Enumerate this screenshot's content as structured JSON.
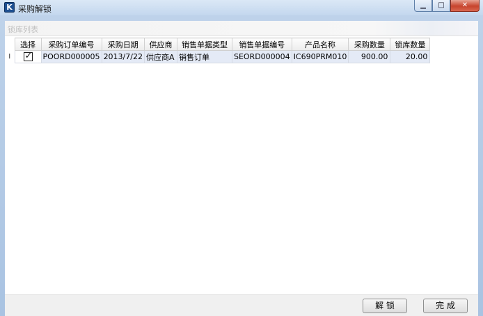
{
  "window": {
    "title": "采购解锁",
    "icon_glyph": "K",
    "controls": {
      "minimize": "▁",
      "maximize": "□",
      "close": "✕"
    }
  },
  "group": {
    "title": "锁库列表"
  },
  "table": {
    "columns": [
      "选择",
      "采购订单编号",
      "采购日期",
      "供应商",
      "销售单据类型",
      "销售单据编号",
      "产品名称",
      "采购数量",
      "锁库数量"
    ],
    "rows": [
      {
        "row_marker": "I",
        "selected": true,
        "cells": [
          "POORD000005",
          "2013/7/22",
          "供应商A",
          "销售订单",
          "SEORD000004",
          "IC690PRM010",
          "900.00",
          "20.00"
        ]
      }
    ]
  },
  "buttons": {
    "unlock": "解 锁",
    "done": "完 成"
  }
}
